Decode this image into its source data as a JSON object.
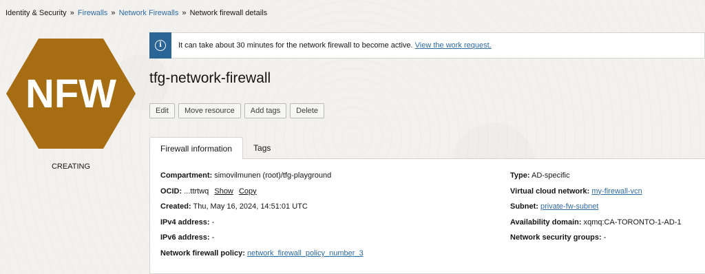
{
  "breadcrumb": {
    "root": "Identity & Security",
    "sep": "»",
    "firewalls": "Firewalls",
    "network_firewalls": "Network Firewalls",
    "current": "Network firewall details"
  },
  "resource_icon": {
    "text": "NFW",
    "color": "#a66d12",
    "state": "CREATING"
  },
  "alert": {
    "icon": "info-icon",
    "message": "It can take about 30 minutes for the network firewall to become active.",
    "link": "View the work request."
  },
  "title": "tfg-network-firewall",
  "actions": {
    "edit": "Edit",
    "move": "Move resource",
    "add_tags": "Add tags",
    "delete": "Delete"
  },
  "tabs": {
    "info": "Firewall information",
    "tags": "Tags"
  },
  "details": {
    "compartment_label": "Compartment:",
    "compartment_value": "simovilmunen (root)/tfg-playground",
    "ocid_label": "OCID:",
    "ocid_value": "...ttrtwq",
    "ocid_show": "Show",
    "ocid_copy": "Copy",
    "created_label": "Created:",
    "created_value": "Thu, May 16, 2024, 14:51:01 UTC",
    "ipv4_label": "IPv4 address:",
    "ipv4_value": "-",
    "ipv6_label": "IPv6 address:",
    "ipv6_value": "-",
    "policy_label": "Network firewall policy:",
    "policy_value": "network_firewall_policy_number_3",
    "type_label": "Type:",
    "type_value": "AD-specific",
    "vcn_label": "Virtual cloud network:",
    "vcn_value": "my-firewall-vcn",
    "subnet_label": "Subnet:",
    "subnet_value": "private-fw-subnet",
    "ad_label": "Availability domain:",
    "ad_value": "xqmq:CA-TORONTO-1-AD-1",
    "nsg_label": "Network security groups:",
    "nsg_value": "-"
  }
}
